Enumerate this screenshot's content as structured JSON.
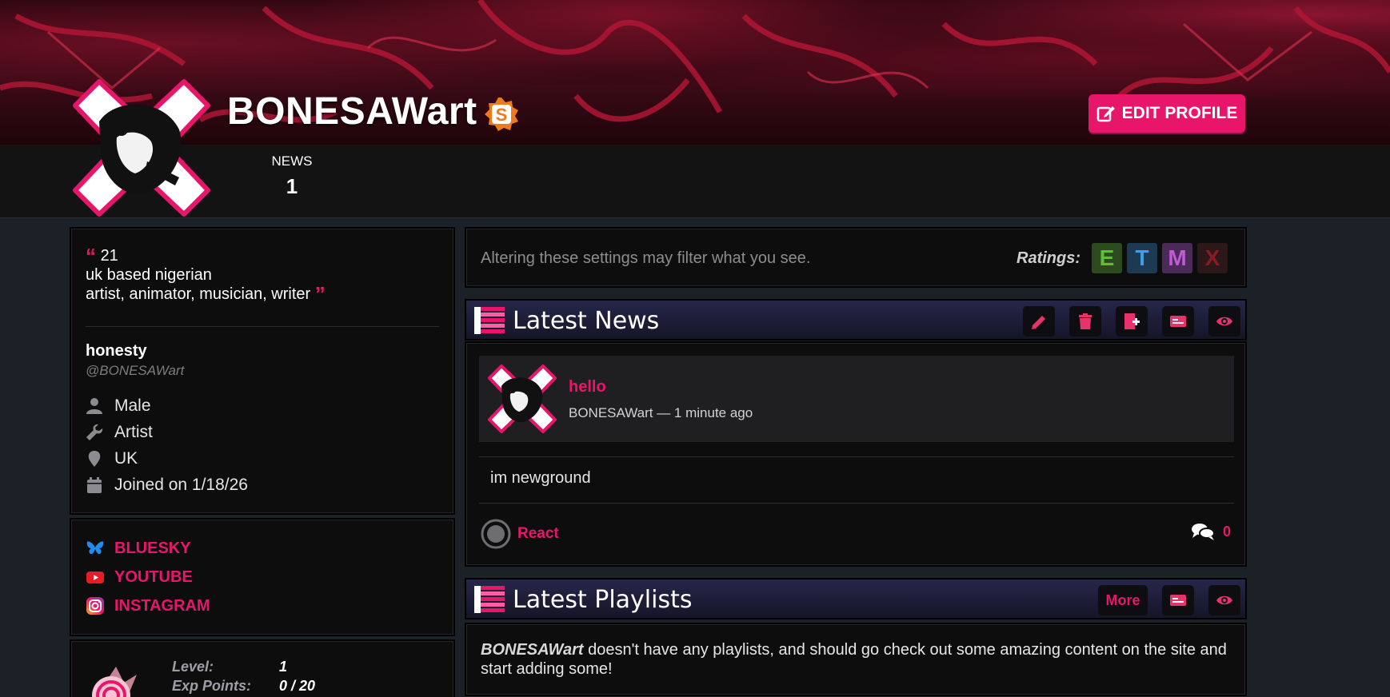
{
  "profile": {
    "username": "BONESAWart",
    "edit_label": "EDIT PROFILE",
    "stats": {
      "news_label": "NEWS",
      "news_count": "1"
    }
  },
  "bio": {
    "line1": "21",
    "line2": "uk based nigerian",
    "line3": "artist, animator, musician, writer",
    "display_name": "honesty",
    "handle": "@BONESAWart",
    "gender": "Male",
    "occupation": "Artist",
    "location": "UK",
    "joined": "Joined on 1/18/26"
  },
  "links": [
    {
      "label": "BLUESKY",
      "icon": "butterfly-icon"
    },
    {
      "label": "YOUTUBE",
      "icon": "youtube-icon"
    },
    {
      "label": "INSTAGRAM",
      "icon": "instagram-icon"
    }
  ],
  "level": {
    "level_label": "Level:",
    "level_value": "1",
    "exp_label": "Exp Points:",
    "exp_value": "0 / 20"
  },
  "filter": {
    "notice": "Altering these settings may filter what you see.",
    "ratings_label": "Ratings:",
    "ratings": [
      {
        "letter": "E",
        "color": "#5ec12a",
        "bg": "#2d4a1e"
      },
      {
        "letter": "T",
        "color": "#3aa0e8",
        "bg": "#1e3a52"
      },
      {
        "letter": "M",
        "color": "#c25ad6",
        "bg": "#4a2a58"
      },
      {
        "letter": "X",
        "color": "#c2202a",
        "bg": "#3a1c1e"
      }
    ]
  },
  "news_section": {
    "title": "Latest News",
    "post": {
      "title": "hello",
      "meta": "BONESAWart — 1 minute ago",
      "body": "im newground",
      "react_label": "React",
      "comment_count": "0"
    }
  },
  "playlists_section": {
    "title": "Latest Playlists",
    "more_label": "More",
    "empty_user": "BONESAWart",
    "empty_text": " doesn't have any playlists, and should go check out some amazing content on the site and start adding some!"
  },
  "colors": {
    "accent": "#e8166a",
    "background": "#1c2127",
    "panel": "#0e0d0e"
  }
}
